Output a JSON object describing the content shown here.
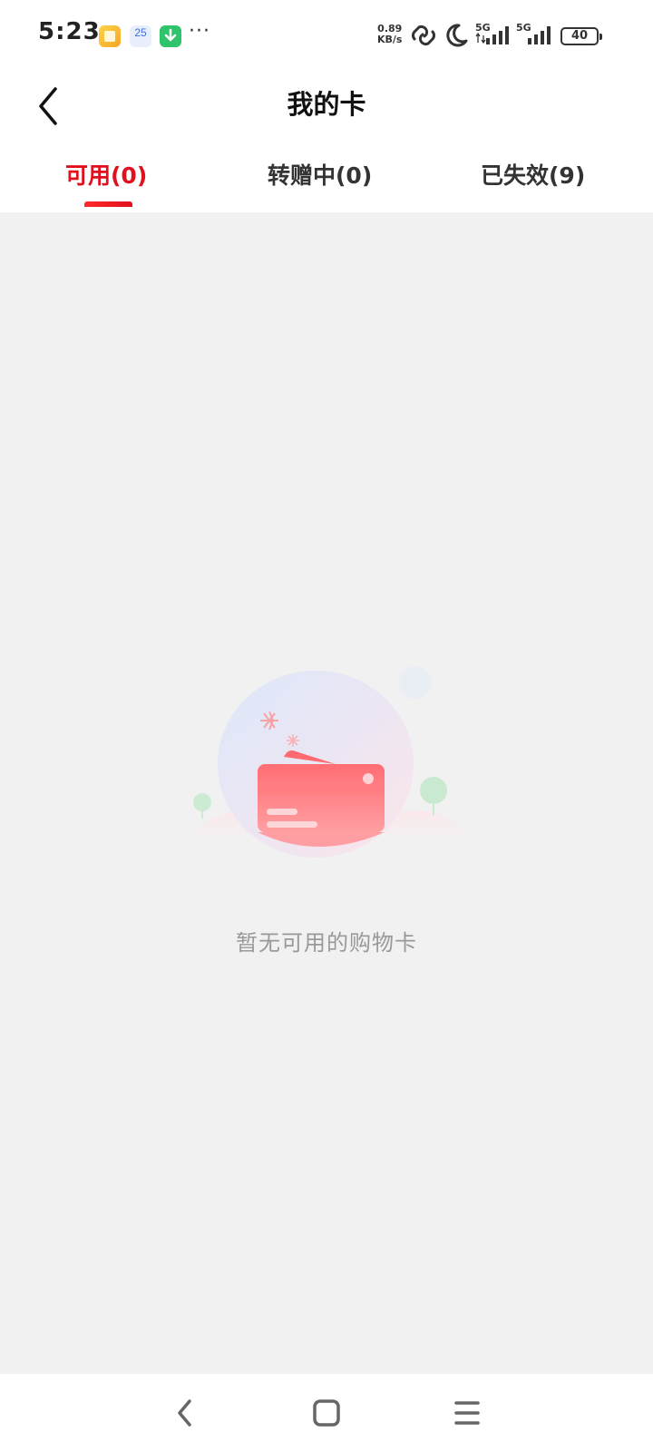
{
  "status_bar": {
    "time": "5:23",
    "calendar_day": "25",
    "more": "···",
    "net_speed_value": "0.89",
    "net_speed_unit": "KB/s",
    "signal1_label": "5G",
    "signal2_label": "5G",
    "battery": "40",
    "icons": [
      "notes-app-icon",
      "calendar-app-icon",
      "download-app-icon",
      "link-icon",
      "moon-icon",
      "signal-icon",
      "signal-icon",
      "battery-icon"
    ]
  },
  "header": {
    "title": "我的卡"
  },
  "tabs": [
    {
      "label": "可用(0)",
      "active": true
    },
    {
      "label": "转赠中(0)",
      "active": false
    },
    {
      "label": "已失效(9)",
      "active": false
    }
  ],
  "empty_state": {
    "message": "暂无可用的购物卡"
  },
  "colors": {
    "accent": "#e0101e",
    "background": "#f1f1f2",
    "card": "#ff7a7f"
  }
}
